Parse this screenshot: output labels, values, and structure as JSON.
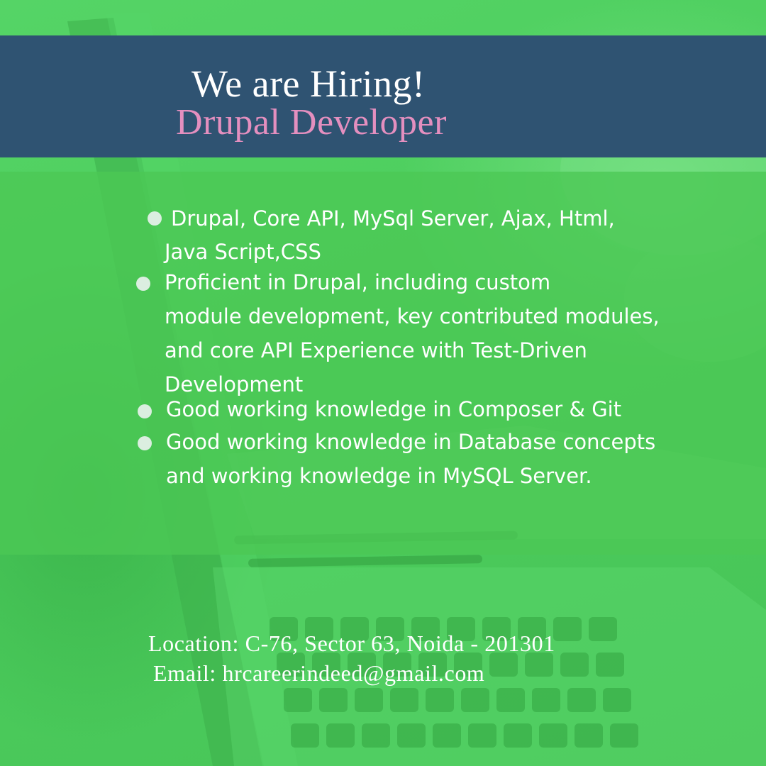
{
  "header": {
    "title": "We are Hiring!",
    "subtitle": "Drupal Developer",
    "subtitle_color": "#e48fbf",
    "band_color": "#2f5372"
  },
  "requirements": [
    {
      "lines": [
        "Drupal, Core API, MySql Server, Ajax, Html,",
        "Java Script,CSS"
      ]
    },
    {
      "lines": [
        "Proficient in Drupal, including custom",
        "module development, key contributed modules,",
        "and core API Experience with Test-Driven",
        "Development"
      ]
    },
    {
      "lines": [
        "Good working knowledge in Composer & Git"
      ]
    },
    {
      "lines": [
        "Good working knowledge in Database concepts",
        "and working knowledge in MySQL Server."
      ]
    }
  ],
  "contact": {
    "location": "Location: C-76, Sector 63, Noida - 201301",
    "email": "Email: hrcareerindeed@gmail.com"
  },
  "colors": {
    "background": "#4fd160",
    "bullet": "#dbeee0",
    "text": "#ffffff"
  },
  "background_image": "laptop-on-desk-photo"
}
